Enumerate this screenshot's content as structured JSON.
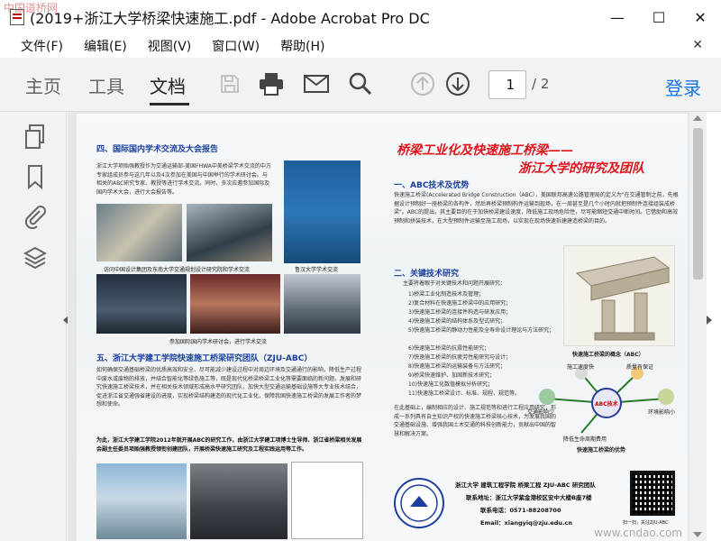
{
  "window": {
    "title": "(2019+浙江大学桥梁快速施工.pdf - Adobe Acrobat Pro DC",
    "minimize": "—",
    "maximize": "☐",
    "close": "✕"
  },
  "menu": {
    "items": [
      "文件(F)",
      "编辑(E)",
      "视图(V)",
      "窗口(W)",
      "帮助(H)"
    ],
    "close_doc": "✕"
  },
  "toolbar": {
    "tabs": [
      "主页",
      "工具",
      "文档"
    ],
    "active_tab": "文档",
    "page_current": "1",
    "page_total": "/ 2",
    "login": "登录"
  },
  "poster": {
    "sec4_title": "四、国际国内学术交流及大会报告",
    "sec4_body": "浙江大学项贻强教授作为交通运输部-美国FHWA中美桥梁学术交流的中方专家组成员参与这几年以及4次参加在美国与中国举行的学术研讨会。与相关的ABC研究专家、教授等进行学术交流。同时，多次应邀参加国际及国内学术大会，进行大会报告等。",
    "caption1": "访问中国设计集团及东南大学交通规划设计研究院和学术交流",
    "caption2": "鲁汉大学学术交流",
    "caption3": "参加国际国内学术研讨会，进行学术交流",
    "sec5_title": "五、浙江大学建工学院快速施工桥梁研究团队（ZJU-ABC）",
    "sec5_body": "如何确保交通基础桥梁的优质高效和安全、尽可能减少建设过程中对周边环境及交通通行的影响，降低生产过程中废水或废物的排放，并结合智能化等绿色施工等，既是现代化桥梁桥梁工业化等需要面临的新问题。发展和研究快速施工桥梁技术，并在相关技术领域形成高水平研究团队，加快大型交通运输基础设施等大专业技术结合，促进浙江省交通强省建设的进度，实现桥梁结构建造的现代化工业化，保障我国快速施工桥梁的发展工作者的梦想和使命。",
    "sec5_body2": "为此，浙江大学建工学院2012年就开展ABC的研究工作，由浙江大学建工项博士生导师、浙江省桥梁相关发展会副主任委员项贻强教授领衔创建团队，开展桥梁快速施工研究及工程实践运用等工作。",
    "banner_line1": "桥梁工业化及快速施工桥梁——",
    "banner_line2": "浙江大学的研究及团队",
    "sec1_title": "一、ABC技术及优势",
    "sec1_body": "快速施工桥梁(Accelerated Bridge Construction（ABC），美国联邦高速公路管理局的定义为\"在交通管制之前，先根据设计预制好一座桥梁的各构件，然后再桥梁预制构件运输到现场，在一周甚至是几个小时内就把预制件连接组装成桥梁\"。ABC的提出，其主要目的在于加快桥梁建设速度，降低施工现场危险性，尽可能缩短交通中断时间。它借助和高效预制和拼装技术，在大型预制件运输至施工现场，以实现在现场快速拆建建造桥梁的目的。",
    "sec2_title": "二、关键技术研究",
    "sec2_intro": "主要将着眼于对关键技术和问题开展研究：",
    "sec2_items": [
      "1)桥梁工业化制造技术及管理；",
      "2)复合材料在快速施工桥梁中的应用研究；",
      "3)快速施工桥梁的连接件构造与研发应用；",
      "4)快速施工桥梁的结构体系及型式研究；",
      "5)快速施工桥梁的静动力性能及全寿命设计理论与方法研究；",
      "6)快速施工桥梁的抗震性能研究；",
      "7)快速施工桥梁的抗疲劳性能研究与设计；",
      "8)快速施工桥梁的运输装备与方法研究；",
      "9)桥梁快速维护、加固新技术研究；",
      "10)快速施工化数值模拟分析研究；",
      "11)快速施工桥梁设计、标准、规程、规范等。"
    ],
    "sec2_outro": "在此基础上，编制相应的设计、施工规范等和进行工程应用研究，形成一系列具有自主知识产权的快速施工桥梁核心技术，为发展我国的交通基础设施、增强我国土木交通的科技创新能力，贡献出中国的智慧和解决方案。",
    "fig_caption1": "快速施工桥梁的概念（ABC）",
    "fig_caption2": "快速施工桥梁的优势",
    "abc_center": "ABC技术",
    "abc_labels": [
      "施工速度快",
      "质量有保证",
      "交通影响少",
      "环境影响小",
      "降低生命周期费用"
    ],
    "contact_org": "浙江大学 建筑工程学院  桥梁工程  ZJU-ABC 研究团队",
    "contact_addr": "联系地址：浙江大学紫金港校区安中大楼B座7楼",
    "contact_tel": "联系电话：0571-88208700",
    "contact_email": "Email：xiangyiq@zju.edu.cn",
    "qr_caption": "扫一扫，关注ZJU-ABC"
  },
  "watermarks": {
    "top_left": "中国道桥网",
    "bottom_right": "www.cndao.com"
  },
  "colors": {
    "accent_blue": "#1473e6",
    "poster_heading": "#1a3f9c",
    "banner_red": "#e0121a",
    "toolbar_bg": "#f2f2f2"
  }
}
